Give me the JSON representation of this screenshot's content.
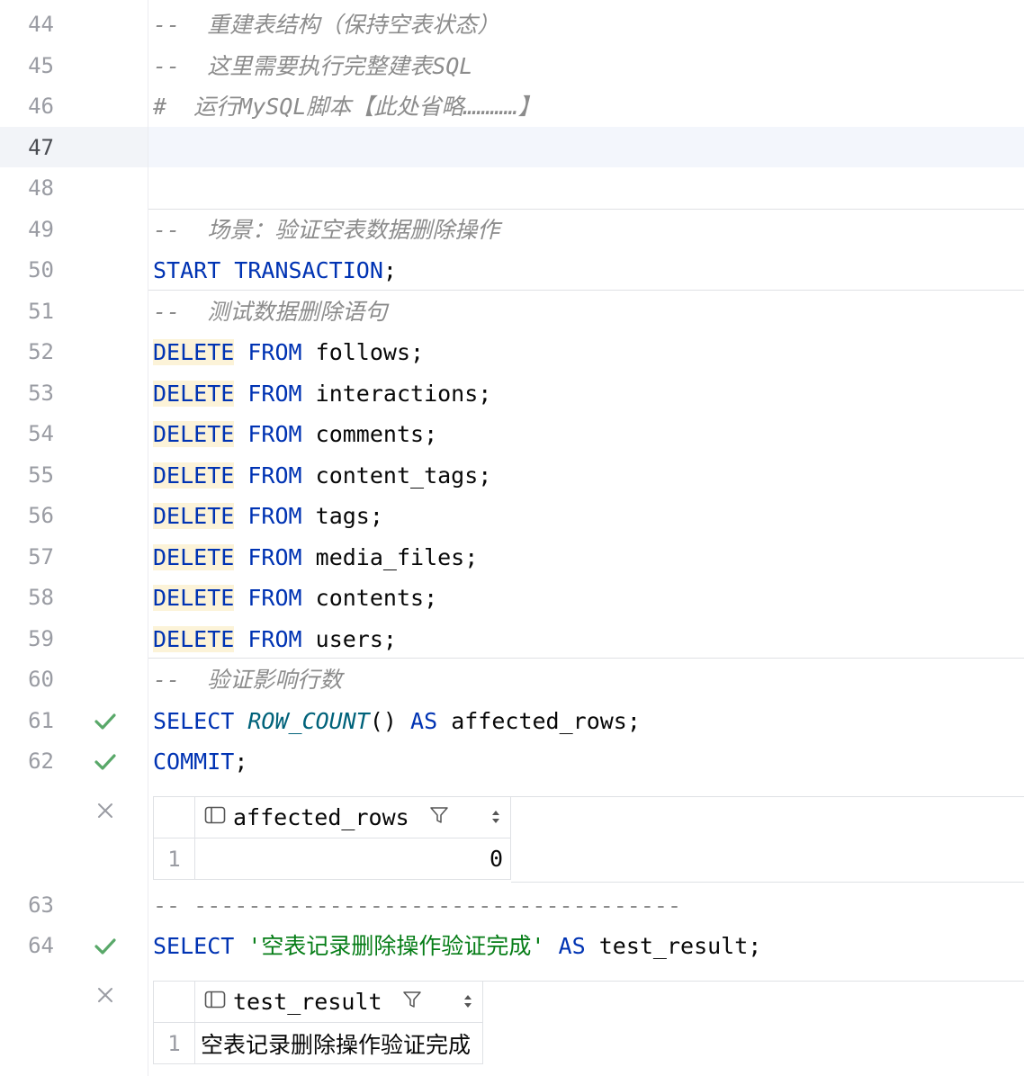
{
  "editor": {
    "lines": [
      {
        "n": "44",
        "text": "--  重建表结构（保持空表状态）",
        "type": "comment"
      },
      {
        "n": "45",
        "text": "--  这里需要执行完整建表SQL",
        "type": "comment"
      },
      {
        "n": "46",
        "text": "#  运行MySQL脚本【此处省略…………】",
        "type": "comment"
      },
      {
        "n": "47",
        "text": "",
        "type": "blank"
      },
      {
        "n": "48",
        "text": "",
        "type": "blank"
      },
      {
        "n": "49",
        "text": "--  场景：验证空表数据删除操作",
        "type": "comment"
      },
      {
        "n": "50",
        "kw1": "START TRANSACTION",
        "punct": ";"
      },
      {
        "n": "51",
        "text": "--  测试数据删除语句",
        "type": "comment"
      },
      {
        "n": "52",
        "kw1": "DELETE",
        "kw2": "FROM",
        "ident": "follows;"
      },
      {
        "n": "53",
        "kw1": "DELETE",
        "kw2": "FROM",
        "ident": "interactions;"
      },
      {
        "n": "54",
        "kw1": "DELETE",
        "kw2": "FROM",
        "ident": "comments;"
      },
      {
        "n": "55",
        "kw1": "DELETE",
        "kw2": "FROM",
        "ident": "content_tags;"
      },
      {
        "n": "56",
        "kw1": "DELETE",
        "kw2": "FROM",
        "ident": "tags;"
      },
      {
        "n": "57",
        "kw1": "DELETE",
        "kw2": "FROM",
        "ident": "media_files;"
      },
      {
        "n": "58",
        "kw1": "DELETE",
        "kw2": "FROM",
        "ident": "contents;"
      },
      {
        "n": "59",
        "kw1": "DELETE",
        "kw2": "FROM",
        "ident": "users;"
      },
      {
        "n": "60",
        "text": "--  验证影响行数",
        "type": "comment"
      },
      {
        "n": "61",
        "kw1": "SELECT",
        "fn": "ROW_COUNT",
        "paren": "()",
        "kw2": "AS",
        "ident": "affected_rows;"
      },
      {
        "n": "62",
        "kw1": "COMMIT",
        "punct": ";"
      },
      {
        "n": "63",
        "text": "-- ------------------------------------",
        "type": "comment"
      },
      {
        "n": "64",
        "kw1": "SELECT",
        "str": "'空表记录删除操作验证完成'",
        "kw2": "AS",
        "ident": "test_result;"
      }
    ]
  },
  "result1": {
    "column": "affected_rows",
    "row_number": "1",
    "value": "0"
  },
  "result2": {
    "column": "test_result",
    "row_number": "1",
    "value": "空表记录删除操作验证完成"
  },
  "colors": {
    "keyword": "#0033b3",
    "function": "#00627a",
    "string": "#067d17",
    "comment": "#8c8c8c",
    "check": "#59a869"
  }
}
